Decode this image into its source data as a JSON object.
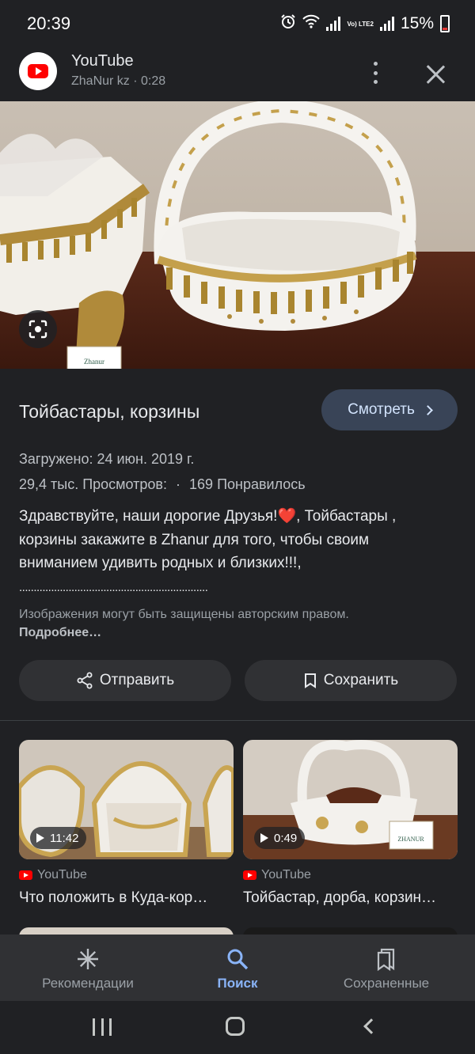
{
  "status_bar": {
    "time": "20:39",
    "battery": "15%",
    "network": "Vo) LTE2",
    "icons": [
      "alarm-icon",
      "wifi-icon",
      "signal-icon",
      "signal-icon",
      "battery-icon"
    ]
  },
  "header": {
    "source": "YouTube",
    "channel_duration": "ZhaNur kz · 0:28"
  },
  "hero": {
    "sign_text": "Zhanur"
  },
  "result": {
    "title": "Тойбастары, корзины",
    "watch_label": "Смотреть",
    "uploaded": "Загружено: 24 июн. 2019 г.",
    "views": "29,4 тыс. Просмотров:",
    "separator": "·",
    "likes": "169 Понравилось",
    "description_text": "Здравствуйте, наши дорогие Друзья!",
    "description_emoji": "❤️",
    "description_rest": ", Тойбастары , корзины закажите в Zhanur для того, чтобы своим вниманием удивить родных и близких!!!,",
    "description_dots": ".................................................................",
    "copyright_text": "Изображения могут быть защищены авторским правом.",
    "copyright_link": "Подробнее…"
  },
  "actions": {
    "share_label": "Отправить",
    "save_label": "Сохранить"
  },
  "related": [
    {
      "duration": "11:42",
      "source": "YouTube",
      "title": "Что положить в Куда-кор…"
    },
    {
      "duration": "0:49",
      "source": "YouTube",
      "title": "Тойбастар, дорба, корзин…",
      "sign_text": "ZHANUR"
    }
  ],
  "bottom_nav": [
    {
      "label": "Рекомендации",
      "icon": "asterisk-icon",
      "active": false
    },
    {
      "label": "Поиск",
      "icon": "search-icon",
      "active": true
    },
    {
      "label": "Сохраненные",
      "icon": "bookmarks-icon",
      "active": false
    }
  ],
  "colors": {
    "background": "#202124",
    "accent": "#8ab4f8",
    "watch_button": "#394457",
    "brand_red": "#ff0000"
  }
}
